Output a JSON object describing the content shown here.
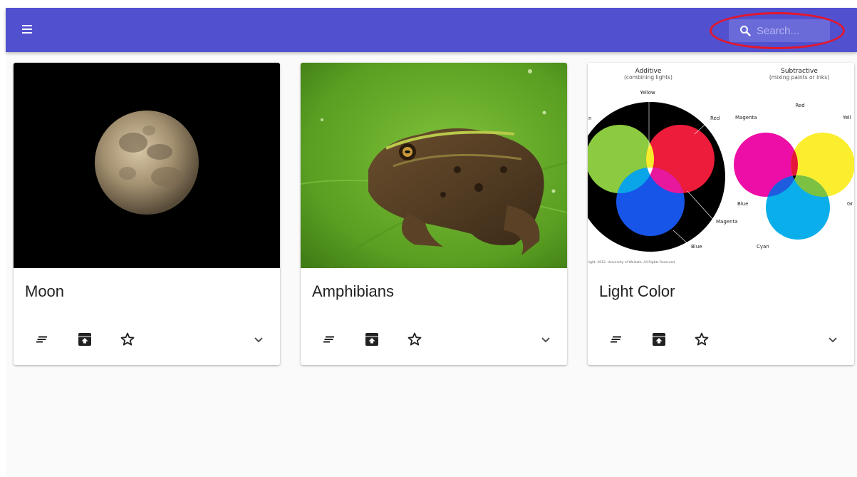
{
  "appbar": {
    "menu_icon": "menu-icon",
    "search": {
      "placeholder": "Search...",
      "icon": "search-icon",
      "highlight_color": "#e3172b"
    },
    "color": "#5151d0"
  },
  "cards": [
    {
      "title": "Moon",
      "media": "moon-photo",
      "actions": [
        "notes-icon",
        "archive-icon",
        "star-outline-icon"
      ],
      "expand_icon": "chevron-down-icon"
    },
    {
      "title": "Amphibians",
      "media": "frog-photo",
      "actions": [
        "notes-icon",
        "archive-icon",
        "star-outline-icon"
      ],
      "expand_icon": "chevron-down-icon"
    },
    {
      "title": "Light Color",
      "media": "color-mixing-diagram",
      "diagram": {
        "additive_title": "Additive",
        "additive_subtitle": "(combining lights)",
        "subtractive_title": "Subtractive",
        "subtractive_subtitle": "(mixing paints or inks)",
        "labels": {
          "yellow": "Yellow",
          "red": "Red",
          "magenta": "Magenta",
          "blue": "Blue",
          "cyan": "Cyan",
          "red2": "Red",
          "magenta2": "Magenta",
          "yellow2": "Yell",
          "blue2": "Blue",
          "green2": "Gr",
          "green_left": "n"
        },
        "copyright": "right. 2012. University of Waikato. All Rights Reserved."
      },
      "actions": [
        "notes-icon",
        "archive-icon",
        "star-outline-icon"
      ],
      "expand_icon": "chevron-down-icon"
    }
  ]
}
